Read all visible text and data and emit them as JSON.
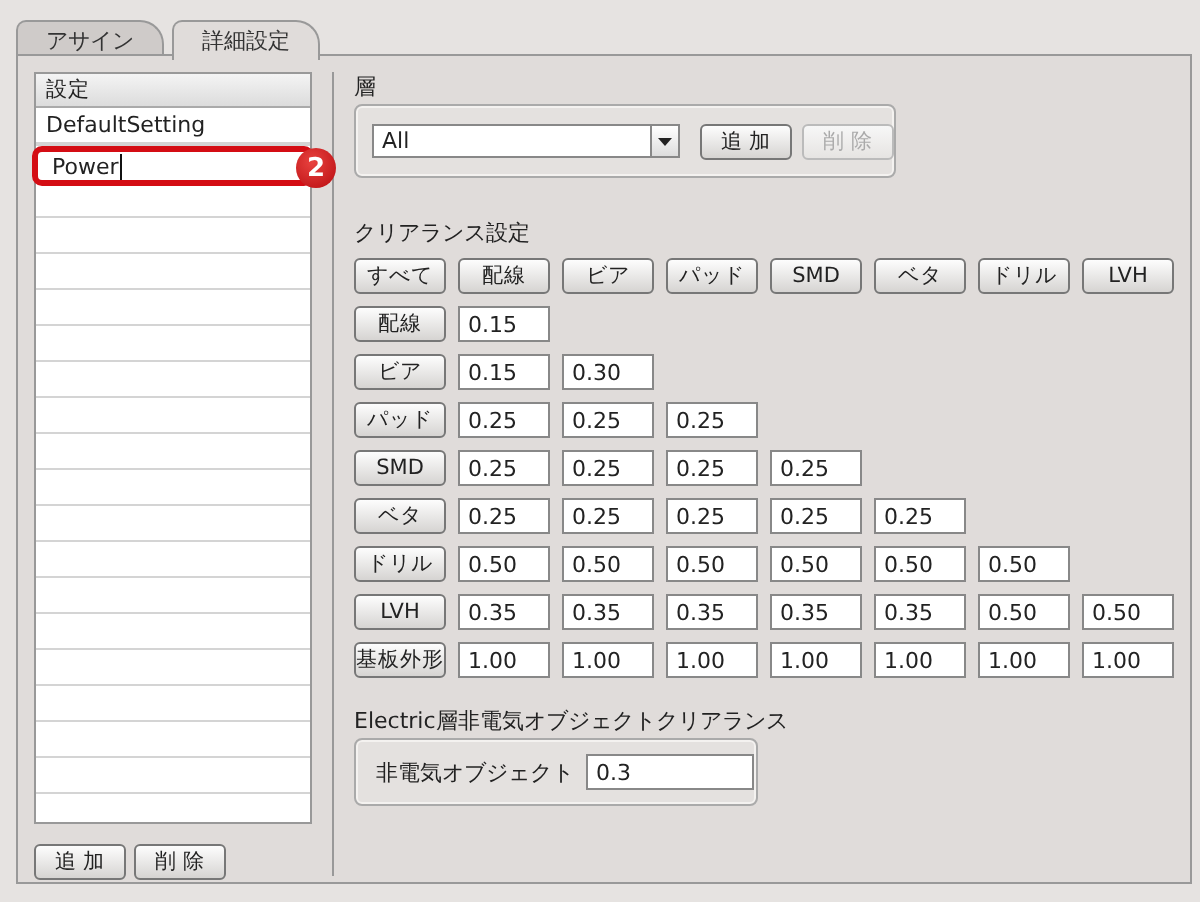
{
  "tabs": [
    {
      "label": "アサイン",
      "selected": false
    },
    {
      "label": "詳細設定",
      "selected": true
    }
  ],
  "settings_list": {
    "header": "設定",
    "callout": "2",
    "items": [
      {
        "label": "DefaultSetting",
        "editing": false,
        "highlighted": false
      },
      {
        "label": "Power",
        "editing": true,
        "highlighted": true
      }
    ],
    "buttons": [
      {
        "label": "追 加",
        "disabled": false
      },
      {
        "label": "削 除",
        "disabled": false
      }
    ]
  },
  "layer": {
    "label": "層",
    "value": "All",
    "buttons": [
      {
        "label": "追 加",
        "disabled": false
      },
      {
        "label": "削 除",
        "disabled": true
      }
    ]
  },
  "clearance": {
    "title": "クリアランス設定",
    "header_buttons": [
      "すべて",
      "配線",
      "ビア",
      "パッド",
      "SMD",
      "ベタ",
      "ドリル",
      "LVH"
    ],
    "rows": [
      {
        "label": "配線",
        "values": [
          "0.15"
        ]
      },
      {
        "label": "ビア",
        "values": [
          "0.15",
          "0.30"
        ]
      },
      {
        "label": "パッド",
        "values": [
          "0.25",
          "0.25",
          "0.25"
        ]
      },
      {
        "label": "SMD",
        "values": [
          "0.25",
          "0.25",
          "0.25",
          "0.25"
        ]
      },
      {
        "label": "ベタ",
        "values": [
          "0.25",
          "0.25",
          "0.25",
          "0.25",
          "0.25"
        ]
      },
      {
        "label": "ドリル",
        "values": [
          "0.50",
          "0.50",
          "0.50",
          "0.50",
          "0.50",
          "0.50"
        ]
      },
      {
        "label": "LVH",
        "values": [
          "0.35",
          "0.35",
          "0.35",
          "0.35",
          "0.35",
          "0.50",
          "0.50"
        ]
      },
      {
        "label": "基板外形",
        "values": [
          "1.00",
          "1.00",
          "1.00",
          "1.00",
          "1.00",
          "1.00",
          "1.00"
        ]
      }
    ]
  },
  "electric": {
    "title": "Electric層非電気オブジェクトクリアランス",
    "field_label": "非電気オブジェクト",
    "value": "0.3"
  }
}
